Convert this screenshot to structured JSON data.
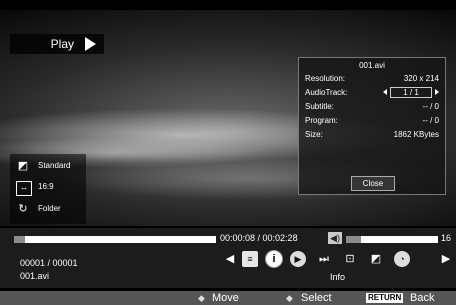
{
  "overlay": {
    "play_label": "Play"
  },
  "info": {
    "filename": "001.avi",
    "rows": {
      "resolution": {
        "label": "Resolution:",
        "value": "320 x 214"
      },
      "audiotrack": {
        "label": "AudioTrack:",
        "value": "1 / 1"
      },
      "subtitle": {
        "label": "Subtitle:",
        "value": "-- / 0"
      },
      "program": {
        "label": "Program:",
        "value": "-- / 0"
      },
      "size": {
        "label": "Size:",
        "value": "1862 KBytes"
      }
    },
    "close_label": "Close"
  },
  "side": {
    "picture_mode": "Standard",
    "aspect": "16:9",
    "repeat": "Folder"
  },
  "playback": {
    "time": "00:00:08 / 00:02:28",
    "progress_fraction": 0.054,
    "volume": "16",
    "volume_fraction": 0.16,
    "file_count": "00001 / 00001",
    "file_name": "001.avi",
    "selected_caption": "Info",
    "controls": [
      "prev-arrow-icon",
      "playlist-icon",
      "info-icon",
      "step-forward-icon",
      "next-track-icon",
      "aspect-ratio-icon",
      "picture-mode-icon",
      "sleep-timer-icon",
      "next-arrow-icon"
    ]
  },
  "footer": {
    "move": "Move",
    "select": "Select",
    "return_key": "RETURN",
    "back": "Back"
  }
}
